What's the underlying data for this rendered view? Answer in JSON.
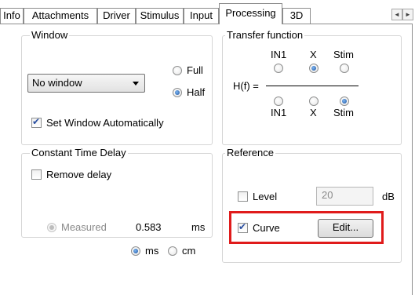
{
  "tabs": [
    "Info",
    "Attachments",
    "Driver",
    "Stimulus",
    "Input",
    "Processing",
    "3D"
  ],
  "active_tab": "Processing",
  "scroll_arrows": {
    "left": "◄",
    "right": "►"
  },
  "window_group": {
    "title": "Window",
    "combo_value": "No window",
    "radio_full": "Full",
    "radio_half": "Half",
    "selected": "Half",
    "checkbox_label": "Set Window Automatically",
    "checkbox_checked": true
  },
  "transfer_group": {
    "title": "Transfer function",
    "hf_label": "H(f) =",
    "top_labels": [
      "IN1",
      "X",
      "Stim"
    ],
    "bottom_labels": [
      "IN1",
      "X",
      "Stim"
    ],
    "numerator_selected": "X",
    "denominator_selected": "Stim"
  },
  "delay_group": {
    "title": "Constant Time Delay",
    "remove_delay_label": "Remove delay",
    "remove_delay_checked": false,
    "measured_label": "Measured",
    "measured_value": "0.583",
    "measured_unit": "ms",
    "unit_ms": "ms",
    "unit_cm": "cm",
    "unit_selected": "ms"
  },
  "reference_group": {
    "title": "Reference",
    "level_label": "Level",
    "level_checked": false,
    "level_value": "20",
    "level_unit": "dB",
    "curve_label": "Curve",
    "curve_checked": true,
    "edit_button": "Edit..."
  },
  "colors": {
    "highlight": "#e01b1b",
    "radio_selected": "#1a4f9c",
    "check_mark": "#2a4fa0"
  }
}
